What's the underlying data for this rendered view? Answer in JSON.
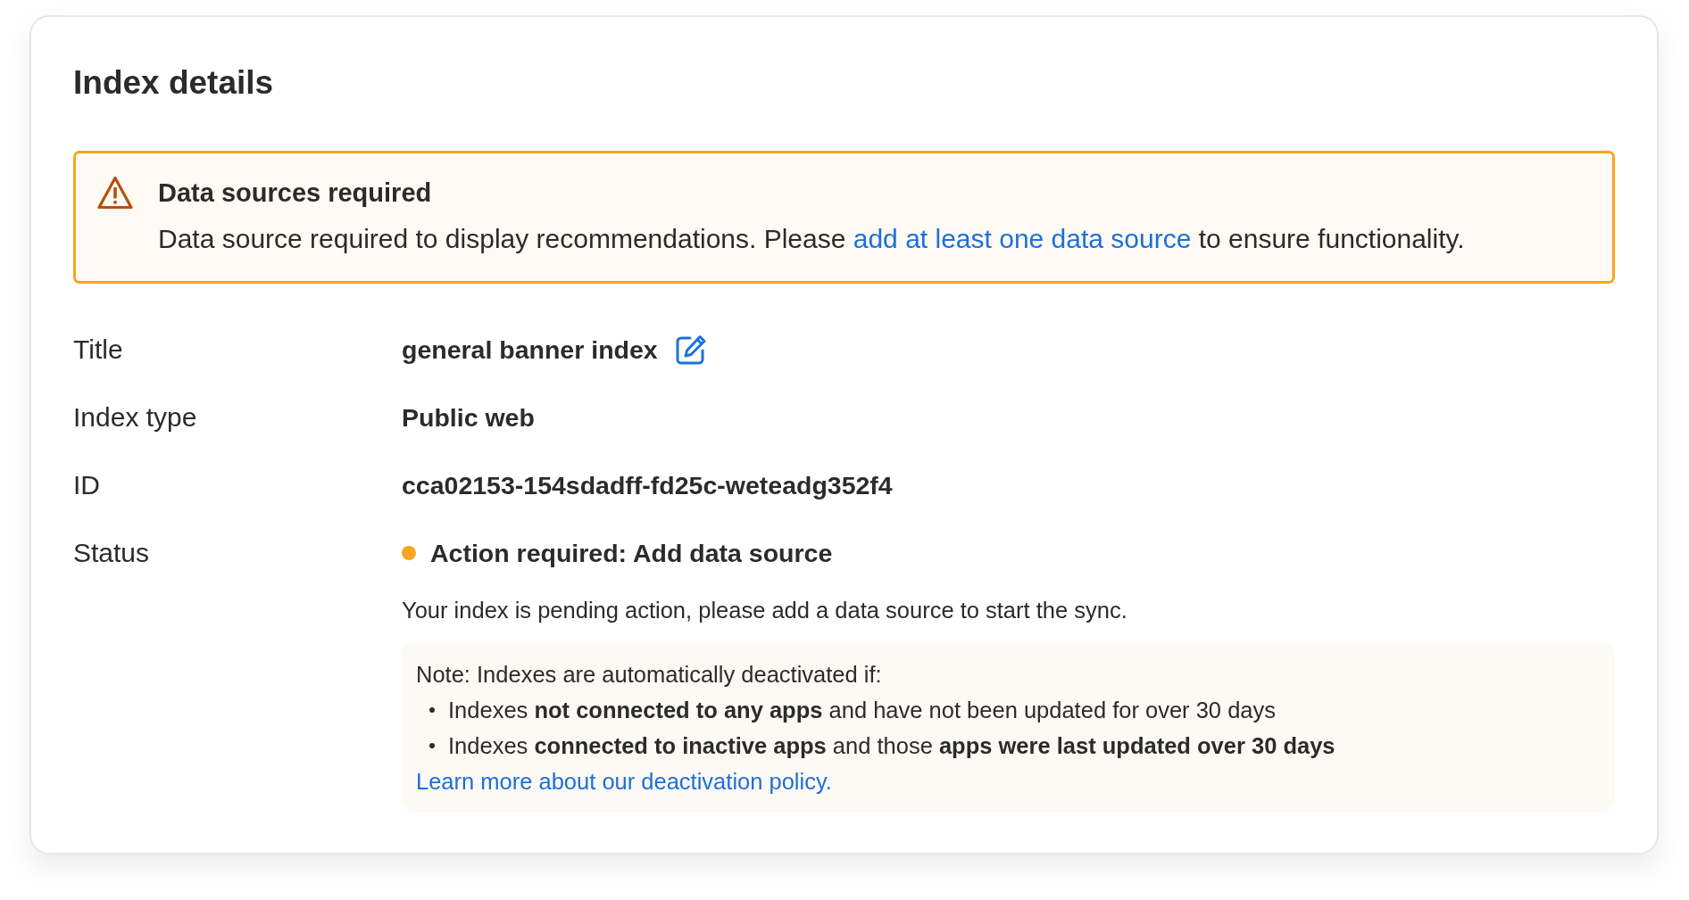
{
  "card": {
    "title": "Index details"
  },
  "alert": {
    "kind": "warning",
    "title": "Data sources required",
    "message": [
      {
        "kind": "text",
        "text": "Data source required to display recommendations. Please "
      },
      {
        "kind": "link",
        "text": "add at least one data source"
      },
      {
        "kind": "text",
        "text": " to ensure functionality."
      }
    ]
  },
  "details": [
    {
      "kind": "text",
      "label": "Title",
      "value": "general banner index",
      "editable": true
    },
    {
      "kind": "text",
      "label": "Index type",
      "value": "Public web",
      "editable": false
    },
    {
      "kind": "text",
      "label": "ID",
      "value": "cca02153-154sdadff-fd25c-weteadg352f4",
      "editable": false
    },
    {
      "kind": "status",
      "label": "Status",
      "value": "Action required: Add data source",
      "color": "#f7a51e",
      "editable": false,
      "description": "Your index is pending action, please add a data source to start the sync.",
      "note": {
        "heading": "Note: Indexes are automatically deactivated if:",
        "bullets": [
          "Indexes **not connected to any apps** and have not been updated for over 30 days",
          "Indexes **connected to inactive apps** and those **apps were last updated over 30 days**"
        ],
        "link": "Learn more about our deactivation policy."
      }
    }
  ]
}
